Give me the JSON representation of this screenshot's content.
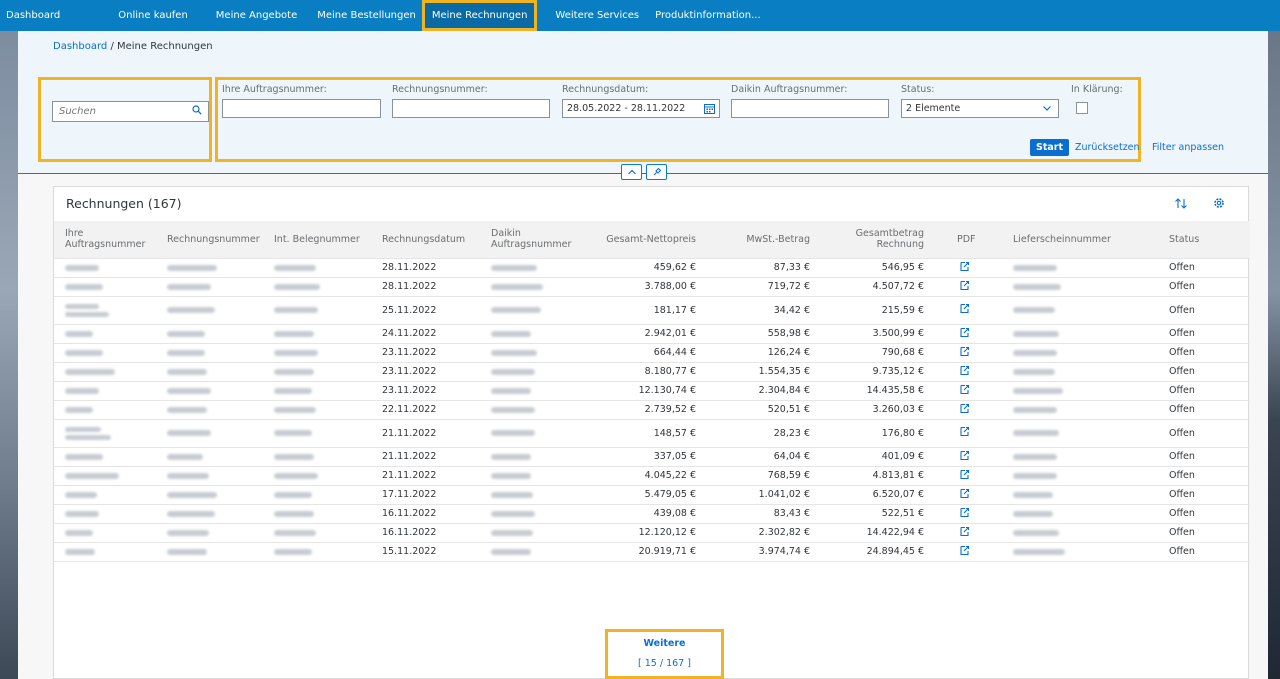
{
  "nav": {
    "items": [
      {
        "label": "Dashboard",
        "active": false
      },
      {
        "label": "Online kaufen",
        "active": false
      },
      {
        "label": "Meine Angebote",
        "active": false
      },
      {
        "label": "Meine Bestellungen",
        "active": false
      },
      {
        "label": "Meine Rechnungen",
        "active": true
      },
      {
        "label": "Weitere Services",
        "active": false
      },
      {
        "label": "Produktinformation...",
        "active": false
      }
    ]
  },
  "breadcrumb": {
    "link": "Dashboard",
    "separator": " / ",
    "current": "Meine Rechnungen"
  },
  "search": {
    "placeholder": "Suchen"
  },
  "filters": {
    "order_label": "Ihre Auftragsnummer:",
    "invoice_label": "Rechnungsnummer:",
    "date_label": "Rechnungsdatum:",
    "date_value": "28.05.2022 - 28.11.2022",
    "daikin_label": "Daikin Auftragsnummer:",
    "status_label": "Status:",
    "status_value": "2 Elemente",
    "clarify_label": "In Klärung:",
    "start": "Start",
    "reset": "Zurücksetzen",
    "adapt": "Filter anpassen"
  },
  "table": {
    "title": "Rechnungen (167)",
    "columns": [
      "Ihre Auftragsnummer",
      "Rechnungsnummer",
      "Int. Belegnummer",
      "Rechnungsdatum",
      "Daikin Auftragsnummer",
      "Gesamt-Nettopreis",
      "MwSt.-Betrag",
      "Gesamtbetrag Rechnung",
      "PDF",
      "Lieferscheinnummer",
      "Status"
    ],
    "rows": [
      {
        "date": "28.11.2022",
        "net": "459,62 €",
        "vat": "87,33 €",
        "total": "546,95 €",
        "status": "Offen",
        "tall": false
      },
      {
        "date": "28.11.2022",
        "net": "3.788,00 €",
        "vat": "719,72 €",
        "total": "4.507,72 €",
        "status": "Offen",
        "tall": false
      },
      {
        "date": "25.11.2022",
        "net": "181,17 €",
        "vat": "34,42 €",
        "total": "215,59 €",
        "status": "Offen",
        "tall": true
      },
      {
        "date": "24.11.2022",
        "net": "2.942,01 €",
        "vat": "558,98 €",
        "total": "3.500,99 €",
        "status": "Offen",
        "tall": false
      },
      {
        "date": "23.11.2022",
        "net": "664,44 €",
        "vat": "126,24 €",
        "total": "790,68 €",
        "status": "Offen",
        "tall": false
      },
      {
        "date": "23.11.2022",
        "net": "8.180,77 €",
        "vat": "1.554,35 €",
        "total": "9.735,12 €",
        "status": "Offen",
        "tall": false
      },
      {
        "date": "23.11.2022",
        "net": "12.130,74 €",
        "vat": "2.304,84 €",
        "total": "14.435,58 €",
        "status": "Offen",
        "tall": false
      },
      {
        "date": "22.11.2022",
        "net": "2.739,52 €",
        "vat": "520,51 €",
        "total": "3.260,03 €",
        "status": "Offen",
        "tall": false
      },
      {
        "date": "21.11.2022",
        "net": "148,57 €",
        "vat": "28,23 €",
        "total": "176,80 €",
        "status": "Offen",
        "tall": true
      },
      {
        "date": "21.11.2022",
        "net": "337,05 €",
        "vat": "64,04 €",
        "total": "401,09 €",
        "status": "Offen",
        "tall": false
      },
      {
        "date": "21.11.2022",
        "net": "4.045,22 €",
        "vat": "768,59 €",
        "total": "4.813,81 €",
        "status": "Offen",
        "tall": false
      },
      {
        "date": "17.11.2022",
        "net": "5.479,05 €",
        "vat": "1.041,02 €",
        "total": "6.520,07 €",
        "status": "Offen",
        "tall": false
      },
      {
        "date": "16.11.2022",
        "net": "439,08 €",
        "vat": "83,43 €",
        "total": "522,51 €",
        "status": "Offen",
        "tall": false
      },
      {
        "date": "16.11.2022",
        "net": "12.120,12 €",
        "vat": "2.302,82 €",
        "total": "14.422,94 €",
        "status": "Offen",
        "tall": false
      },
      {
        "date": "15.11.2022",
        "net": "20.919,71 €",
        "vat": "3.974,74 €",
        "total": "24.894,45 €",
        "status": "Offen",
        "tall": false
      }
    ]
  },
  "more": {
    "label": "Weitere",
    "count": "[ 15 / 167 ]"
  },
  "colors": {
    "nav": "#0a7ec2",
    "accent": "#0a6ed1",
    "highlight": "#f0b323"
  }
}
